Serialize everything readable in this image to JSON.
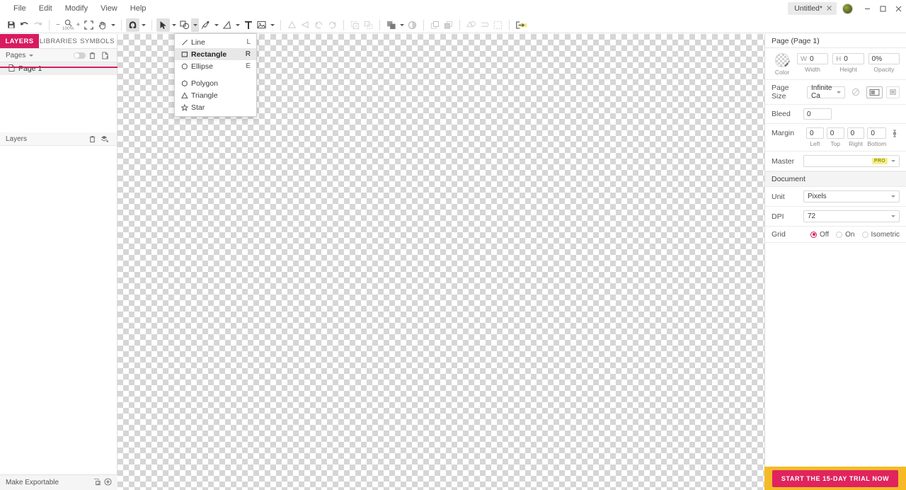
{
  "window": {
    "document_tab": "Untitled*",
    "close_tab_icon": "close-icon",
    "minimize": "—",
    "maximize": "□",
    "close": "✕"
  },
  "menubar": {
    "items": [
      {
        "label": "File"
      },
      {
        "label": "Edit"
      },
      {
        "label": "Modify"
      },
      {
        "label": "View"
      },
      {
        "label": "Help"
      }
    ]
  },
  "toolbar": {
    "zoom_level": "100%",
    "groups": [
      {
        "name": "file",
        "buttons": [
          "save-icon",
          "undo-icon",
          "redo-icon"
        ]
      },
      {
        "name": "zoom",
        "buttons": [
          "zoom-out-icon",
          "zoom-icon",
          "zoom-in-icon",
          "fit-screen-icon",
          "pan-hand-icon"
        ]
      },
      {
        "name": "snap",
        "buttons": [
          "magnet-snap-icon"
        ]
      },
      {
        "name": "tools",
        "buttons": [
          "select-arrow-icon",
          "shape-tool-icon",
          "pen-tool-icon",
          "pencil-icon",
          "text-tool-icon",
          "image-tool-icon"
        ]
      },
      {
        "name": "transform",
        "buttons": [
          "align-icon",
          "flip-icon",
          "rotate-ccw-icon",
          "rotate-cw-icon"
        ]
      },
      {
        "name": "group",
        "buttons": [
          "group-icon",
          "ungroup-icon"
        ]
      },
      {
        "name": "boolean",
        "buttons": [
          "boolean-union-icon",
          "boolean-divide-icon"
        ]
      },
      {
        "name": "order",
        "buttons": [
          "bring-forward-icon",
          "send-backward-icon"
        ]
      },
      {
        "name": "shape-ops",
        "buttons": [
          "merge-icon",
          "path-icon",
          "mask-icon"
        ]
      },
      {
        "name": "export",
        "buttons": [
          "export-pro-icon"
        ]
      }
    ]
  },
  "shape_menu": {
    "items": [
      {
        "label": "Line",
        "shortcut": "L",
        "icon": "line-icon",
        "highlighted": false
      },
      {
        "label": "Rectangle",
        "shortcut": "R",
        "icon": "rectangle-icon",
        "highlighted": true
      },
      {
        "label": "Ellipse",
        "shortcut": "E",
        "icon": "ellipse-icon",
        "highlighted": false
      },
      {
        "label": "Polygon",
        "shortcut": "",
        "icon": "polygon-icon",
        "highlighted": false
      },
      {
        "label": "Triangle",
        "shortcut": "",
        "icon": "triangle-icon",
        "highlighted": false
      },
      {
        "label": "Star",
        "shortcut": "",
        "icon": "star-icon",
        "highlighted": false
      }
    ]
  },
  "left_panel": {
    "tabs": [
      {
        "label": "LAYERS",
        "active": true
      },
      {
        "label": "LIBRARIES",
        "active": false
      },
      {
        "label": "SYMBOLS",
        "active": false
      }
    ],
    "pages_section": {
      "title": "Pages",
      "toggle": "visibility-toggle",
      "delete_icon": "trash-icon",
      "add_icon": "add-page-icon",
      "items": [
        {
          "label": "Page 1",
          "icon": "page-icon",
          "selected": true
        }
      ]
    },
    "layers_section": {
      "title": "Layers",
      "delete_icon": "trash-icon",
      "add_icon": "add-layer-icon",
      "items": []
    },
    "footer": {
      "label": "Make Exportable",
      "slice_icon": "slice-icon",
      "add_icon": "plus-circle-icon"
    }
  },
  "right_panel": {
    "header": "Page (Page 1)",
    "color": {
      "label": "Color",
      "swatch": "transparent-checker"
    },
    "width": {
      "prefix": "W",
      "value": "0",
      "label": "Width"
    },
    "height": {
      "prefix": "H",
      "value": "0",
      "label": "Height"
    },
    "opacity": {
      "value": "0%",
      "label": "Opacity"
    },
    "page_size": {
      "label": "Page Size",
      "value": "Infinite Ca",
      "orientation_buttons": [
        {
          "icon": "no-orientation-icon",
          "selected": false
        },
        {
          "icon": "landscape-icon",
          "selected": true
        },
        {
          "icon": "portrait-icon",
          "selected": false
        }
      ]
    },
    "bleed": {
      "label": "Bleed",
      "value": "0"
    },
    "margin": {
      "label": "Margin",
      "fields": [
        {
          "value": "0",
          "label": "Left"
        },
        {
          "value": "0",
          "label": "Top"
        },
        {
          "value": "0",
          "label": "Right"
        },
        {
          "value": "0",
          "label": "Bottom"
        }
      ],
      "link_icon": "link-margins-icon"
    },
    "master": {
      "label": "Master",
      "value": "",
      "badge": "PRO"
    },
    "document_header": "Document",
    "unit": {
      "label": "Unit",
      "value": "Pixels"
    },
    "dpi": {
      "label": "DPI",
      "value": "72"
    },
    "grid": {
      "label": "Grid",
      "options": [
        {
          "label": "Off",
          "selected": true
        },
        {
          "label": "On",
          "selected": false
        },
        {
          "label": "Isometric",
          "selected": false
        }
      ]
    }
  },
  "cta": {
    "label": "START THE 15-DAY TRIAL NOW",
    "background": "#f5bb26",
    "button_color": "#e0245e"
  },
  "colors": {
    "accent": "#d81b60",
    "panel_bg": "#ffffff",
    "section_bg": "#f4f4f4",
    "border": "#dcdcdc"
  }
}
